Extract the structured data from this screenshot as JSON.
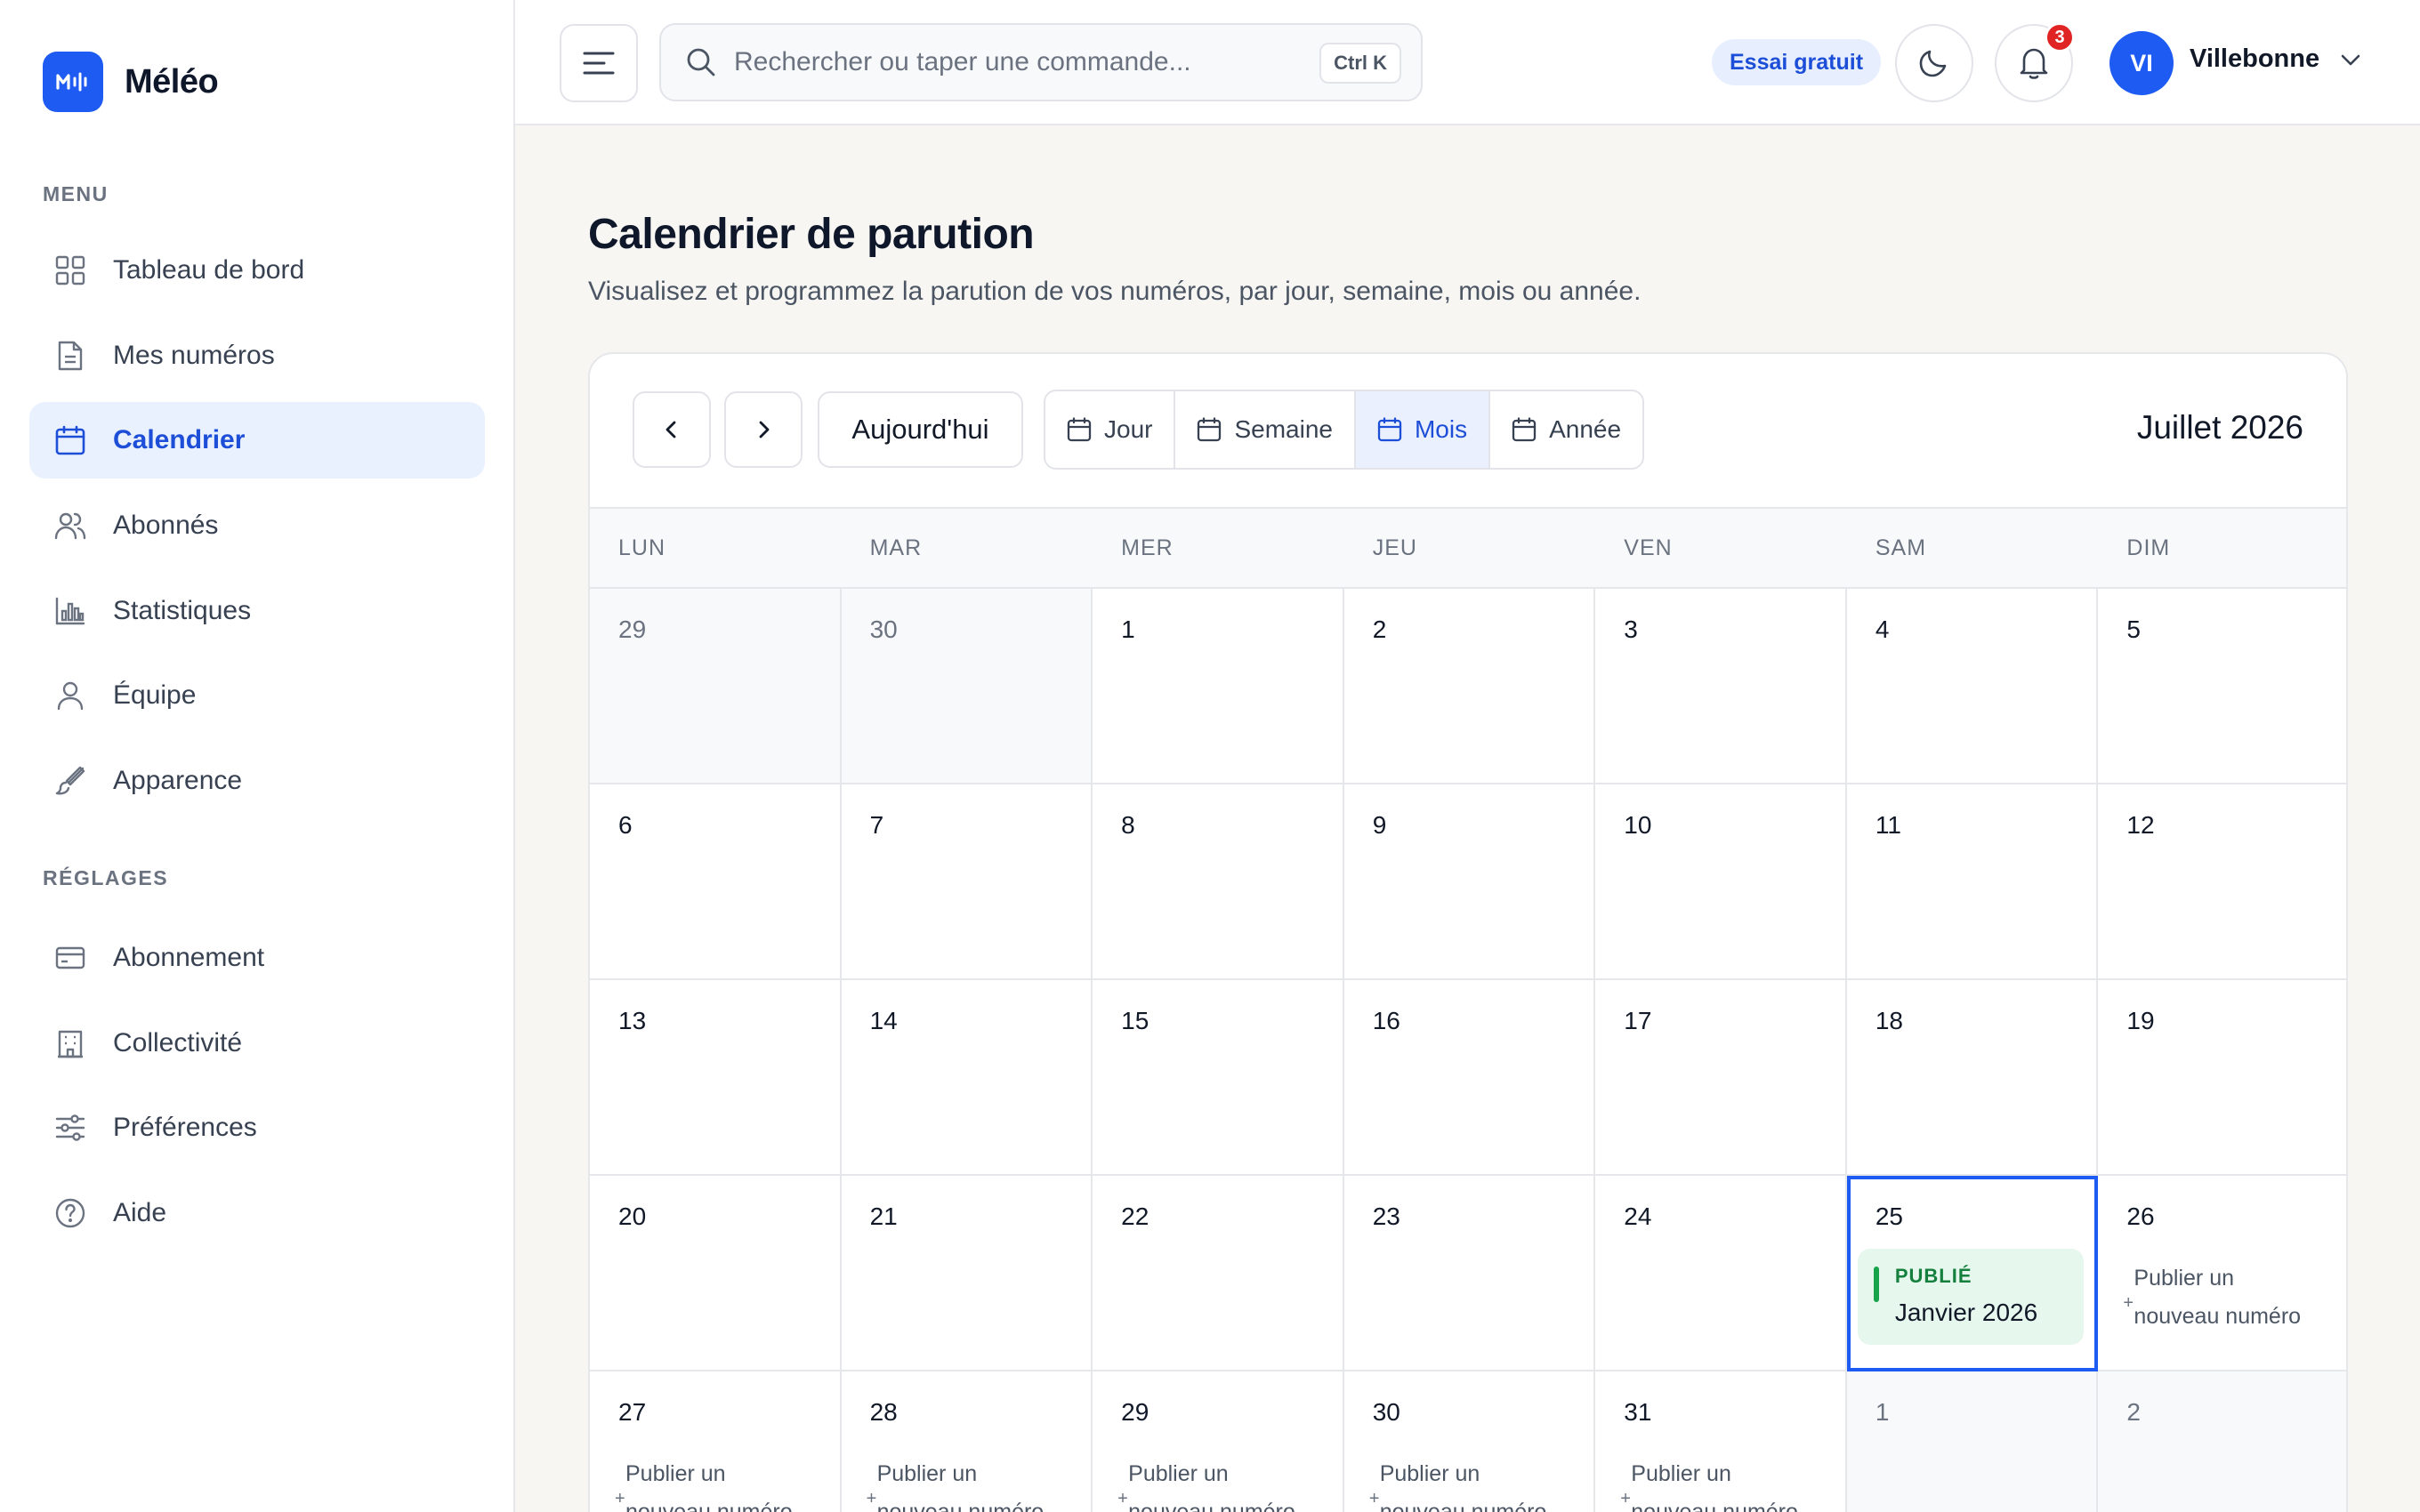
{
  "app": {
    "name": "Méléo"
  },
  "sidebar": {
    "menu_label": "MENU",
    "settings_label": "RÉGLAGES",
    "menu_items": [
      {
        "label": "Tableau de bord",
        "icon": "dashboard-icon"
      },
      {
        "label": "Mes numéros",
        "icon": "document-icon"
      },
      {
        "label": "Calendrier",
        "icon": "calendar-icon",
        "active": true
      },
      {
        "label": "Abonnés",
        "icon": "users-icon"
      },
      {
        "label": "Statistiques",
        "icon": "bar-chart-icon"
      },
      {
        "label": "Équipe",
        "icon": "user-icon"
      },
      {
        "label": "Apparence",
        "icon": "brush-icon"
      }
    ],
    "settings_items": [
      {
        "label": "Abonnement",
        "icon": "credit-card-icon"
      },
      {
        "label": "Collectivité",
        "icon": "building-icon"
      },
      {
        "label": "Préférences",
        "icon": "sliders-icon"
      },
      {
        "label": "Aide",
        "icon": "help-icon"
      }
    ]
  },
  "topbar": {
    "search_placeholder": "Rechercher ou taper une commande...",
    "search_shortcut": "Ctrl K",
    "trial_label": "Essai gratuit",
    "notification_count": "3",
    "user_initials": "VI",
    "user_name": "Villebonne"
  },
  "page": {
    "title": "Calendrier de parution",
    "subtitle": "Visualisez et programmez la parution de vos numéros, par jour, semaine, mois ou année."
  },
  "calendar": {
    "today_label": "Aujourd'hui",
    "views": [
      "Jour",
      "Semaine",
      "Mois",
      "Année"
    ],
    "active_view": "Mois",
    "month_label": "Juillet 2026",
    "weekdays": [
      "LUN",
      "MAR",
      "MER",
      "JEU",
      "VEN",
      "SAM",
      "DIM"
    ],
    "add_label": "Publier un nouveau numéro",
    "days": [
      {
        "n": "29",
        "other": true
      },
      {
        "n": "30",
        "other": true
      },
      {
        "n": "1"
      },
      {
        "n": "2"
      },
      {
        "n": "3"
      },
      {
        "n": "4"
      },
      {
        "n": "5"
      },
      {
        "n": "6"
      },
      {
        "n": "7"
      },
      {
        "n": "8"
      },
      {
        "n": "9"
      },
      {
        "n": "10"
      },
      {
        "n": "11"
      },
      {
        "n": "12"
      },
      {
        "n": "13"
      },
      {
        "n": "14"
      },
      {
        "n": "15"
      },
      {
        "n": "16"
      },
      {
        "n": "17"
      },
      {
        "n": "18"
      },
      {
        "n": "19"
      },
      {
        "n": "20"
      },
      {
        "n": "21"
      },
      {
        "n": "22"
      },
      {
        "n": "23"
      },
      {
        "n": "24"
      },
      {
        "n": "25",
        "today": true,
        "event": {
          "status": "PUBLIÉ",
          "title": "Janvier 2026"
        }
      },
      {
        "n": "26",
        "add": true
      },
      {
        "n": "27",
        "add": true
      },
      {
        "n": "28",
        "add": true
      },
      {
        "n": "29",
        "add": true
      },
      {
        "n": "30",
        "add": true
      },
      {
        "n": "31",
        "add": true
      },
      {
        "n": "1",
        "other": true
      },
      {
        "n": "2",
        "other": true
      }
    ]
  },
  "colors": {
    "accent": "#1d5bf2",
    "published": "#16a34a",
    "badge": "#e02424"
  }
}
